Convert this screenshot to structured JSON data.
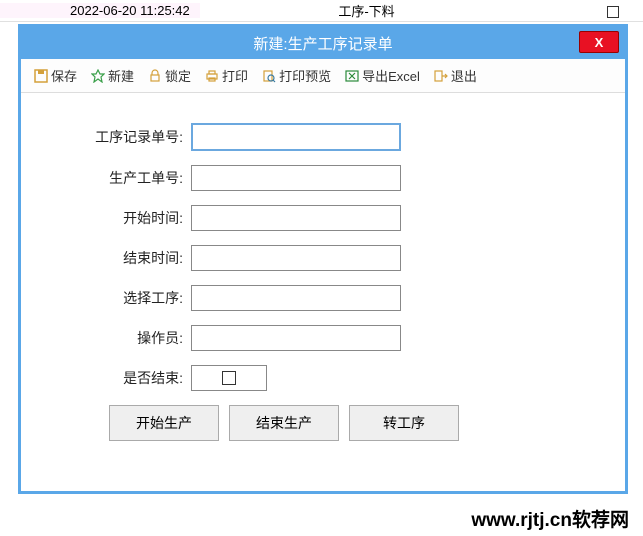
{
  "background": {
    "timestamp": "2022-06-20 11:25:42",
    "process": "工序-下料"
  },
  "dialog": {
    "title": "新建:生产工序记录单",
    "close": "X"
  },
  "toolbar": {
    "save": "保存",
    "new": "新建",
    "lock": "锁定",
    "print": "打印",
    "preview": "打印预览",
    "export": "导出Excel",
    "exit": "退出"
  },
  "form": {
    "record_no_label": "工序记录单号:",
    "record_no_value": "",
    "work_order_label": "生产工单号:",
    "work_order_value": "",
    "start_time_label": "开始时间:",
    "start_time_value": "",
    "end_time_label": "结束时间:",
    "end_time_value": "",
    "select_process_label": "选择工序:",
    "select_process_value": "",
    "operator_label": "操作员:",
    "operator_value": "",
    "is_finished_label": "是否结束:"
  },
  "buttons": {
    "start": "开始生产",
    "end": "结束生产",
    "transfer": "转工序"
  },
  "watermark": "www.rjtj.cn软荐网"
}
